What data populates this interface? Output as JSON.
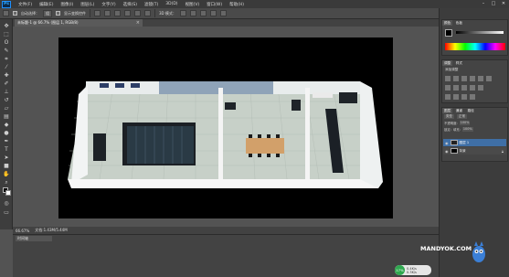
{
  "app": {
    "logo_text": "Ps"
  },
  "menu": {
    "items": [
      "文件(F)",
      "编辑(E)",
      "图像(I)",
      "图层(L)",
      "文字(Y)",
      "选择(S)",
      "滤镜(T)",
      "3D(D)",
      "视图(V)",
      "窗口(W)",
      "帮助(H)"
    ]
  },
  "window_controls": {
    "minimize": "–",
    "maximize": "□",
    "close": "✕"
  },
  "options": {
    "auto_select_label": "自动选择：",
    "auto_select_value": "组",
    "show_transform_label": "显示变换控件",
    "mode_3d_label": "3D 模式："
  },
  "document_tab": {
    "title": "未标题-1 @ 66.7% (图层 1, RGB/8)",
    "close": "×"
  },
  "status": {
    "zoom": "66.67%",
    "doc_info": "文档:1.43M/5.44M"
  },
  "timeline": {
    "tab_label": "时间轴"
  },
  "panels": {
    "color_tabs": [
      "颜色",
      "色板"
    ],
    "adjust_tabs": [
      "调整",
      "样式"
    ],
    "adjust_title": "添加调整",
    "layers_tabs": [
      "图层",
      "通道",
      "路径"
    ],
    "layer_search": "类型",
    "blend_mode": "正常",
    "opacity_label": "不透明度:",
    "opacity": "100%",
    "lock_label": "锁定:",
    "fill_label": "填充:",
    "fill": "100%",
    "layers": [
      {
        "name": "图层 1",
        "selected": true
      },
      {
        "name": "背景",
        "selected": false
      }
    ]
  },
  "watermark": "MANDYOK.COM",
  "badge": {
    "percent": "17%",
    "line1": "0.4K/s",
    "line2": "0.3K/s"
  }
}
